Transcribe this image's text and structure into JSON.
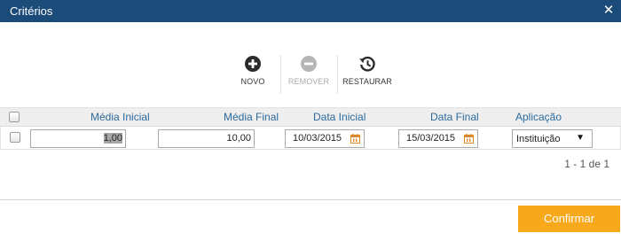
{
  "dialog": {
    "title": "Critérios"
  },
  "toolbar": {
    "novo_label": "NOVO",
    "remover_label": "REMOVER",
    "restaurar_label": "RESTAURAR"
  },
  "table": {
    "headers": {
      "media_inicial": "Média Inicial",
      "media_final": "Média Final",
      "data_inicial": "Data Inicial",
      "data_final": "Data Final",
      "aplicacao": "Aplicação"
    },
    "rows": [
      {
        "media_inicial": "1,00",
        "media_final": "10,00",
        "data_inicial": "10/03/2015",
        "data_final": "15/03/2015",
        "aplicacao": "Instituição"
      }
    ]
  },
  "pager": {
    "text": "1 - 1 de 1"
  },
  "footer": {
    "confirm_label": "Confirmar"
  },
  "colors": {
    "titlebar": "#1b4b79",
    "header_text": "#2c6a9e",
    "confirm": "#f7a81b",
    "calendar_icon": "#e0892a"
  },
  "icons": [
    "close-icon",
    "plus-circle-icon",
    "minus-circle-icon",
    "restore-history-icon",
    "calendar-icon",
    "dropdown-arrow-icon"
  ]
}
